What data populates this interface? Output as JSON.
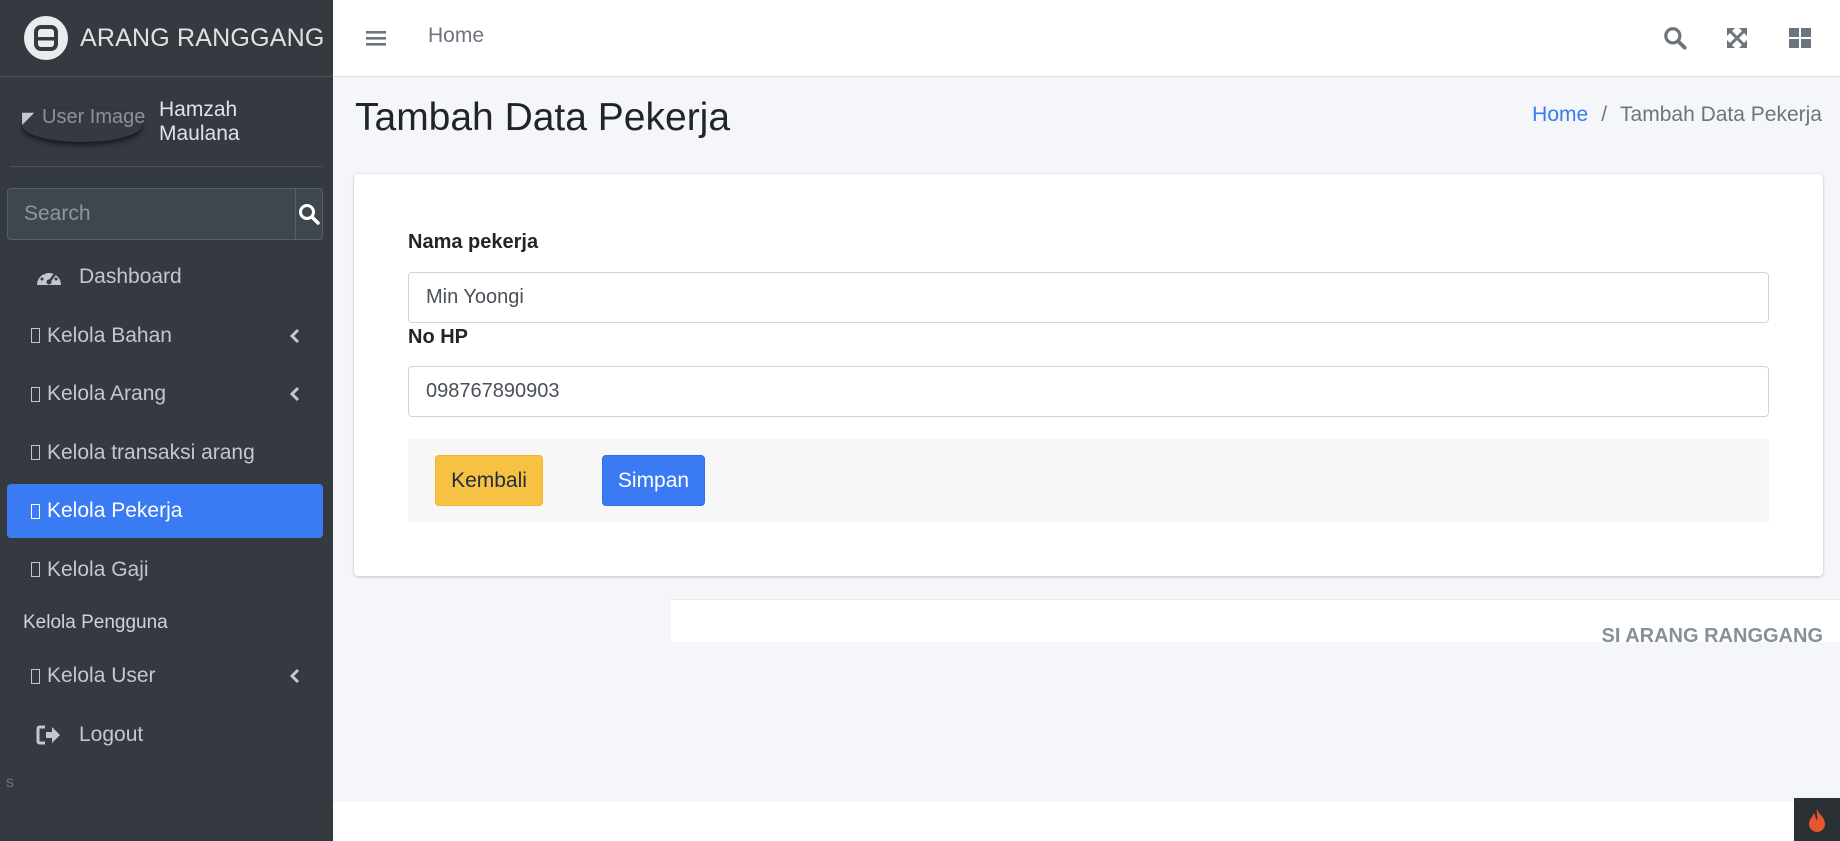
{
  "brand": {
    "name": "ARANG RANGGANG"
  },
  "user": {
    "image_alt": "User Image",
    "name": "Hamzah Maulana"
  },
  "sidebar": {
    "search_placeholder": "Search",
    "items": [
      {
        "label": "Dashboard",
        "icon": "tachometer-icon"
      },
      {
        "label": "Kelola Bahan",
        "icon": "box-icon",
        "has_children": true
      },
      {
        "label": "Kelola Arang",
        "icon": "box-icon",
        "has_children": true
      },
      {
        "label": "Kelola transaksi arang",
        "icon": "box-icon"
      },
      {
        "label": "Kelola Pekerja",
        "icon": "box-icon",
        "active": true
      },
      {
        "label": "Kelola Gaji",
        "icon": "box-icon"
      }
    ],
    "section_header": "Kelola Pengguna",
    "items2": [
      {
        "label": "Kelola User",
        "icon": "box-icon",
        "has_children": true
      },
      {
        "label": "Logout",
        "icon": "sign-out-icon"
      }
    ],
    "stray_text": "s"
  },
  "topbar": {
    "home_link": "Home"
  },
  "page": {
    "title": "Tambah Data Pekerja",
    "breadcrumb": {
      "home": "Home",
      "separator": "/",
      "current": "Tambah Data Pekerja"
    }
  },
  "form": {
    "name_label": "Nama pekerja",
    "name_value": "Min Yoongi",
    "phone_label": "No HP",
    "phone_value": "098767890903",
    "back_button": "Kembali",
    "save_button": "Simpan"
  },
  "footer": {
    "text": "SI ARANG RANGGANG"
  },
  "colors": {
    "accent": "#3a7af3",
    "warning": "#f7c244",
    "sidebar": "#343a40"
  }
}
